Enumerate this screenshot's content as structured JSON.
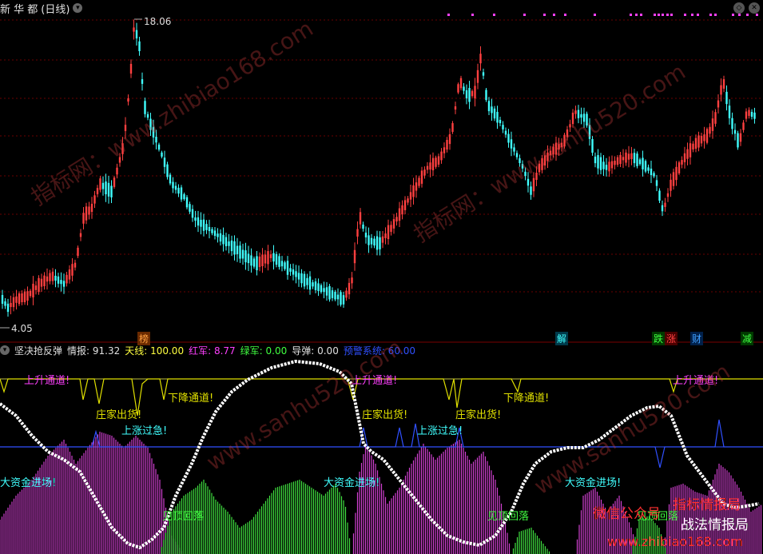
{
  "header": {
    "title": "新 华 都",
    "period": "(日线)"
  },
  "price": {
    "high_label": "18.06",
    "low_label": "4.05"
  },
  "indicator": {
    "name": "坚决抢反弹",
    "values": [
      {
        "label": "情报:",
        "value": "91.32",
        "color": "#e0e0e0"
      },
      {
        "label": "天线:",
        "value": "100.00",
        "color": "#ffff40"
      },
      {
        "label": "红军:",
        "value": "8.77",
        "color": "#ff40ff"
      },
      {
        "label": "绿军:",
        "value": "0.00",
        "color": "#40ff40"
      },
      {
        "label": "导弹:",
        "value": "0.00",
        "color": "#e0e0e0"
      },
      {
        "label": "预警系统:",
        "value": "60.00",
        "color": "#3050ff"
      }
    ]
  },
  "event_tags": [
    {
      "text": "榜",
      "color": "#ffa040",
      "bg": "#6a2a00"
    },
    {
      "text": "解",
      "color": "#40ffff",
      "bg": "#003a4a"
    },
    {
      "text": "跌",
      "color": "#40ff40",
      "bg": "#003a00"
    },
    {
      "text": "涨",
      "color": "#ff4040",
      "bg": "#4a0000"
    },
    {
      "text": "财",
      "color": "#40a0ff",
      "bg": "#00204a"
    },
    {
      "text": "减",
      "color": "#40ff40",
      "bg": "#003a00"
    }
  ],
  "signals": {
    "up_channel": "上升通道!",
    "down_channel": "下降通道!",
    "dealer_ship": "庄家出货!",
    "rise_fast": "上涨过急!",
    "big_funds": "大资金进场!",
    "top_fall": "见顶回落"
  },
  "watermarks": [
    "指标网：www.zhibiao168.com",
    "指标网：www.sanhu520.com",
    "www.sanhu520.com"
  ],
  "promo": {
    "wechat": "微信公众号",
    "brand1": "指标情报局",
    "brand2": "战法情报局",
    "site": "www.zhibiao168.com"
  }
}
